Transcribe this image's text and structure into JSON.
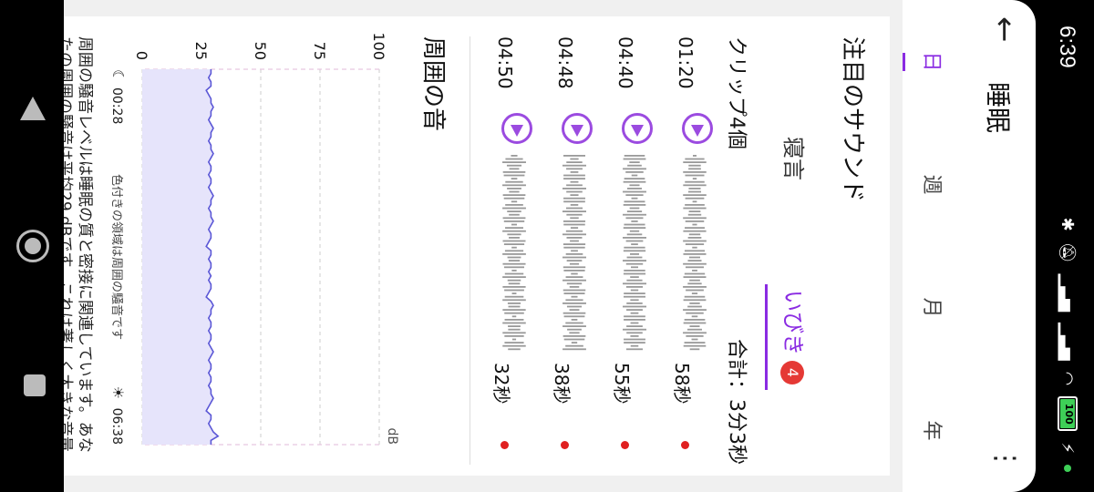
{
  "status_bar": {
    "time": "6:39",
    "icons": [
      "bluetooth-icon",
      "mute-icon",
      "signal-icon",
      "signal-icon",
      "wifi-icon",
      "battery-icon",
      "charging-icon"
    ],
    "battery_level": "100"
  },
  "app_bar": {
    "title": "睡眠",
    "back_icon": "arrow-left-icon",
    "more_icon": "more-vert-icon"
  },
  "period_tabs": [
    {
      "label": "日",
      "active": true
    },
    {
      "label": "週",
      "active": false
    },
    {
      "label": "月",
      "active": false
    },
    {
      "label": "年",
      "active": false
    }
  ],
  "notable_sounds": {
    "title": "注目のサウンド",
    "tabs": [
      {
        "label": "寝言",
        "active": false
      },
      {
        "label": "いびき",
        "active": true,
        "badge": "4"
      }
    ],
    "clip_count": "クリップ4個",
    "total": "合計：3分3秒",
    "clips": [
      {
        "time": "01:20",
        "duration": "58秒"
      },
      {
        "time": "04:40",
        "duration": "55秒"
      },
      {
        "time": "04:48",
        "duration": "38秒"
      },
      {
        "time": "04:50",
        "duration": "32秒"
      }
    ]
  },
  "ambient": {
    "title": "周囲の音",
    "note": "周囲の騒音レベルは睡眠の質と密接に関連しています。あなたの周囲の騒音は平均29 dBです。これは著しく大きな音量で、小雨の音よ",
    "start_time": "00:28",
    "end_time": "06:38",
    "legend": "色付きの領域は周囲の騒音です"
  },
  "chart_data": {
    "type": "area",
    "ylabel": "dB",
    "y_ticks": [
      0,
      25,
      50,
      75,
      100
    ],
    "ylim": [
      0,
      100
    ],
    "x_start": "00:28",
    "x_end": "06:38",
    "values": [
      29,
      29,
      28,
      29,
      29,
      27,
      28,
      29,
      29,
      30,
      29,
      29,
      28,
      29,
      30,
      29,
      29,
      28,
      29,
      29,
      30,
      29,
      28,
      29,
      29,
      28,
      29,
      29,
      28,
      29,
      30,
      29,
      29,
      28,
      29,
      29,
      30,
      29,
      28,
      29,
      29,
      28,
      27,
      29,
      29,
      28,
      29,
      29,
      28,
      29,
      28,
      29,
      29,
      28,
      27,
      29,
      30,
      29,
      29,
      28,
      29,
      29,
      28,
      29,
      29,
      28,
      29,
      30,
      29,
      28,
      29,
      29,
      28,
      29,
      29,
      28,
      29,
      29,
      30,
      29,
      28,
      27,
      29,
      29,
      28,
      29,
      30,
      32,
      29,
      29
    ],
    "colors": {
      "line": "#5b57d6",
      "fill": "#e6e4fb",
      "grid": "#e7c8e0"
    }
  }
}
